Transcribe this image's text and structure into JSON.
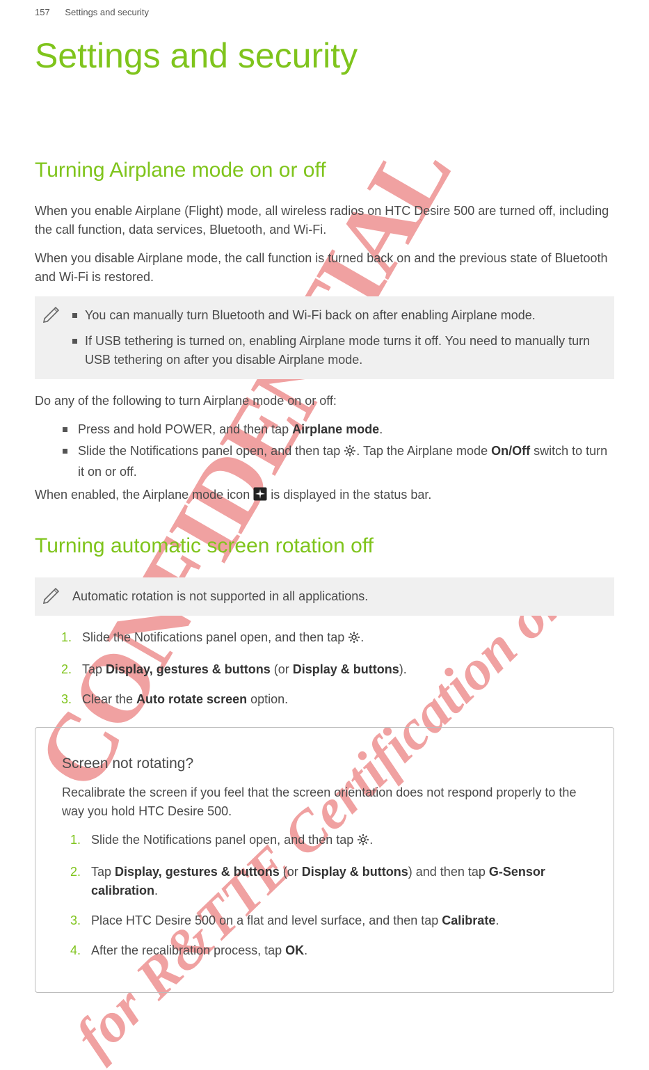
{
  "header": {
    "page_num": "157",
    "running": "Settings and security"
  },
  "title": "Settings and security",
  "s1": {
    "heading": "Turning Airplane mode on or off",
    "p1": "When you enable Airplane (Flight) mode, all wireless radios on HTC Desire 500 are turned off, including the call function, data services, Bluetooth, and Wi-Fi.",
    "p2": "When you disable Airplane mode, the call function is turned back on and the previous state of Bluetooth and Wi-Fi is restored.",
    "note1": "You can manually turn Bluetooth and Wi-Fi back on after enabling Airplane mode.",
    "note2": "If USB tethering is turned on, enabling Airplane mode turns it off. You need to manually turn USB tethering on after you disable Airplane mode.",
    "p3": "Do any of the following to turn Airplane mode on or off:",
    "b1a": "Press and hold POWER, and then tap ",
    "b1b": "Airplane mode",
    "b1c": ".",
    "b2a": "Slide the Notifications panel open, and then tap ",
    "b2b": ". Tap the Airplane mode ",
    "b2c": "On/Off",
    "b2d": " switch to turn it on or off.",
    "p4a": "When enabled, the Airplane mode icon ",
    "p4b": " is displayed in the status bar."
  },
  "s2": {
    "heading": "Turning automatic screen rotation off",
    "note": "Automatic rotation is not supported in all applications.",
    "step1a": "Slide the Notifications panel open, and then tap ",
    "step1b": ".",
    "step2a": "Tap ",
    "step2b": "Display, gestures & buttons",
    "step2c": " (or ",
    "step2d": "Display & buttons",
    "step2e": ").",
    "step3a": "Clear the ",
    "step3b": "Auto rotate screen",
    "step3c": " option."
  },
  "box": {
    "heading": "Screen not rotating?",
    "p": "Recalibrate the screen if you feel that the screen orientation does not respond properly to the way you hold HTC Desire 500.",
    "s1a": "Slide the Notifications panel open, and then tap ",
    "s1b": ".",
    "s2a": "Tap ",
    "s2b": "Display, gestures & buttons",
    "s2c": " (or ",
    "s2d": "Display & buttons",
    "s2e": ") and then tap ",
    "s2f": "G-Sensor calibration",
    "s2g": ".",
    "s3a": "Place HTC Desire 500 on a flat and level surface, and then tap ",
    "s3b": "Calibrate",
    "s3c": ".",
    "s4a": "After the recalibration process, tap ",
    "s4b": "OK",
    "s4c": "."
  },
  "nums": {
    "n1": "1.",
    "n2": "2.",
    "n3": "3.",
    "n4": "4."
  },
  "watermarks": {
    "w1": "CONFIDENTIAL",
    "w2": "for R&TTE Certification on"
  }
}
